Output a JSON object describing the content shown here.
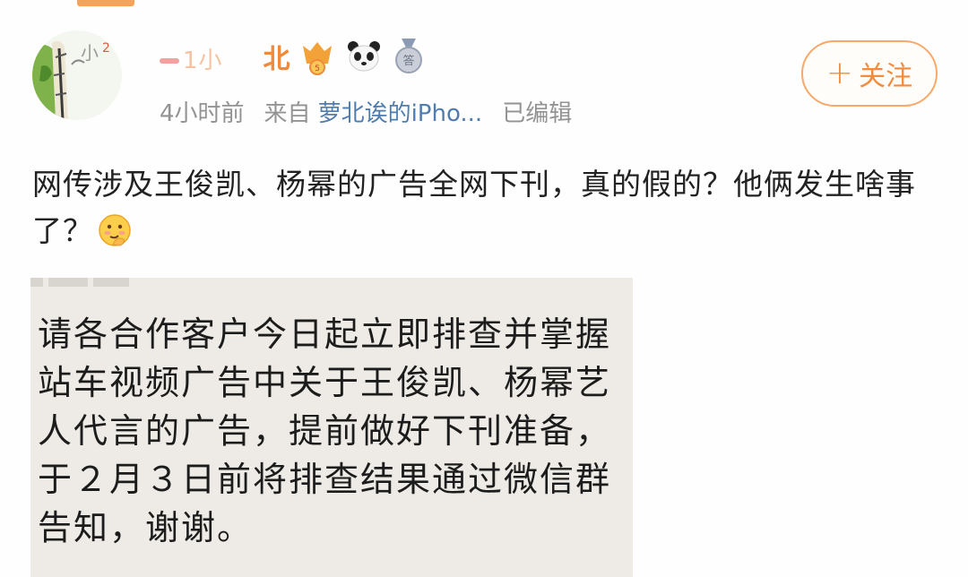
{
  "post": {
    "user": {
      "name_faded": "1小",
      "name": "北",
      "avatar_icon": "avatar-image"
    },
    "badges": [
      "vip-rank-icon",
      "crown-level-icon",
      "panda-icon",
      "medal-icon"
    ],
    "meta": {
      "time": "4小时前",
      "from_label": "来自",
      "source": "萝北诶的iPho...",
      "edited": "已编辑"
    },
    "follow_label": "关注",
    "follow_plus": "+",
    "text": "网传涉及王俊凯、杨幂的广告全网下刊，真的假的？他俩发生啥事了？",
    "emoji": "thinking-face-icon",
    "image_text": "请各合作客户今日起立即排查并掌握站车视频广告中关于王俊凯、杨幂艺人代言的广告，提前做好下刊准备，于２月３日前将排查结果通过微信群告知，谢谢。"
  },
  "colors": {
    "accent": "#f08a3a",
    "link": "#507daf",
    "meta": "#939393",
    "image_bg": "#eeebe6"
  }
}
